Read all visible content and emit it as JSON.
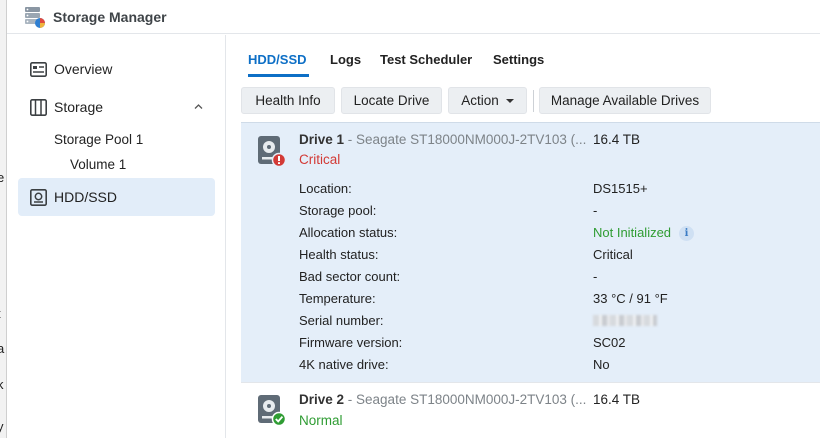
{
  "window": {
    "title": "Storage Manager"
  },
  "desktop_strip": {
    "letters": [
      "e",
      "t",
      "a",
      "k",
      "y"
    ]
  },
  "sidebar": {
    "items": [
      {
        "label": "Overview",
        "icon": "overview-icon"
      },
      {
        "label": "Storage",
        "icon": "storage-icon",
        "expanded": true
      },
      {
        "label": "Storage Pool 1"
      },
      {
        "label": "Volume 1"
      },
      {
        "label": "HDD/SSD",
        "icon": "hdd-icon",
        "active": true
      }
    ]
  },
  "tabs": [
    {
      "label": "HDD/SSD",
      "active": true
    },
    {
      "label": "Logs"
    },
    {
      "label": "Test Scheduler"
    },
    {
      "label": "Settings"
    }
  ],
  "toolbar": {
    "health_info": "Health Info",
    "locate_drive": "Locate Drive",
    "action": "Action",
    "manage_drives": "Manage Available Drives"
  },
  "drives": [
    {
      "name": "Drive 1",
      "model": " - Seagate ST18000NM000J-2TV103 (...",
      "size": "16.4 TB",
      "status": "Critical",
      "status_color": "#d33a36",
      "details": [
        {
          "label": "Location:",
          "value": "DS1515+"
        },
        {
          "label": "Storage pool:",
          "value": "-"
        },
        {
          "label": "Allocation status:",
          "value": "Not Initialized"
        },
        {
          "label": "Health status:",
          "value": "Critical"
        },
        {
          "label": "Bad sector count:",
          "value": "-"
        },
        {
          "label": "Temperature:",
          "value": "33 °C / 91 °F"
        },
        {
          "label": "Serial number:",
          "value": ""
        },
        {
          "label": "Firmware version:",
          "value": "SC02"
        },
        {
          "label": "4K native drive:",
          "value": "No"
        }
      ]
    },
    {
      "name": "Drive 2",
      "model": " - Seagate ST18000NM000J-2TV103 (...",
      "size": "16.4 TB",
      "status": "Normal",
      "status_color": "#2f9c33"
    }
  ],
  "colors": {
    "accent": "#0d6fc6",
    "selected_bg": "#e4eef9",
    "critical": "#d33a36",
    "normal": "#2f9c33"
  }
}
